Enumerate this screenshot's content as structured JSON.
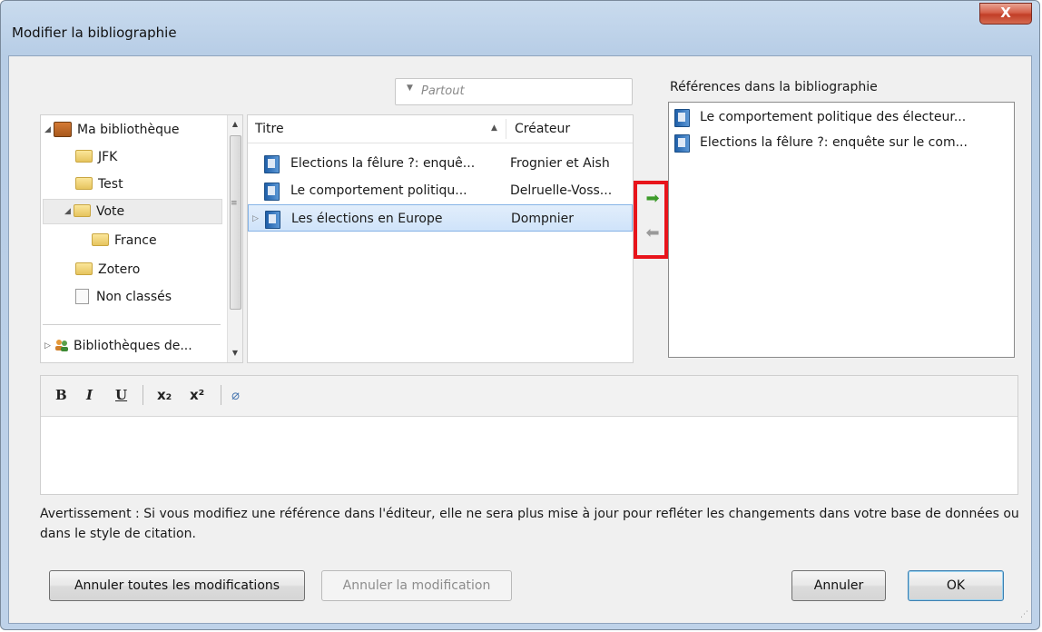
{
  "window": {
    "title": "Modifier la bibliographie",
    "close_glyph": "X"
  },
  "search": {
    "placeholder": "Partout"
  },
  "collections": {
    "items": [
      {
        "label": "Ma bibliothèque",
        "icon": "library-icon"
      },
      {
        "label": "JFK",
        "icon": "folder-icon"
      },
      {
        "label": "Test",
        "icon": "folder-icon"
      },
      {
        "label": "Vote",
        "icon": "folder-icon",
        "selected": true
      },
      {
        "label": "France",
        "icon": "folder-icon"
      },
      {
        "label": "Zotero",
        "icon": "folder-icon"
      },
      {
        "label": "Non classés",
        "icon": "unfiled-icon"
      },
      {
        "label": "Bibliothèques de...",
        "icon": "group-libraries-icon"
      }
    ]
  },
  "items_table": {
    "columns": [
      "Titre",
      "Créateur"
    ],
    "rows": [
      {
        "title": "Elections la fêlure ?: enquê...",
        "creator": "Frognier et Aish"
      },
      {
        "title": "Le comportement politiqu...",
        "creator": "Delruelle-Voss..."
      },
      {
        "title": "Les élections en Europe",
        "creator": "Dompnier",
        "selected": true
      }
    ]
  },
  "bibliography": {
    "label": "Références dans la bibliographie",
    "items": [
      "Le comportement politique des électeur...",
      "Elections la fêlure ?: enquête sur le com..."
    ]
  },
  "editor": {
    "toolbar": {
      "bold": "B",
      "italic": "I",
      "underline": "U",
      "subscript": "x₂",
      "superscript": "x²",
      "clear": "⌀"
    },
    "content": ""
  },
  "warning": "Avertissement : Si vous modifiez une référence dans l'éditeur, elle ne sera plus mise à jour pour refléter les changements dans votre base de données ou dans le style de citation.",
  "buttons": {
    "revert_all": "Annuler toutes les modifications",
    "revert": "Annuler la modification",
    "cancel": "Annuler",
    "ok": "OK"
  },
  "colors": {
    "highlight_box": "#e8141b",
    "add_arrow": "#3c9a2a",
    "remove_arrow": "#9a9a9a",
    "selection": "#cfe3fa"
  }
}
